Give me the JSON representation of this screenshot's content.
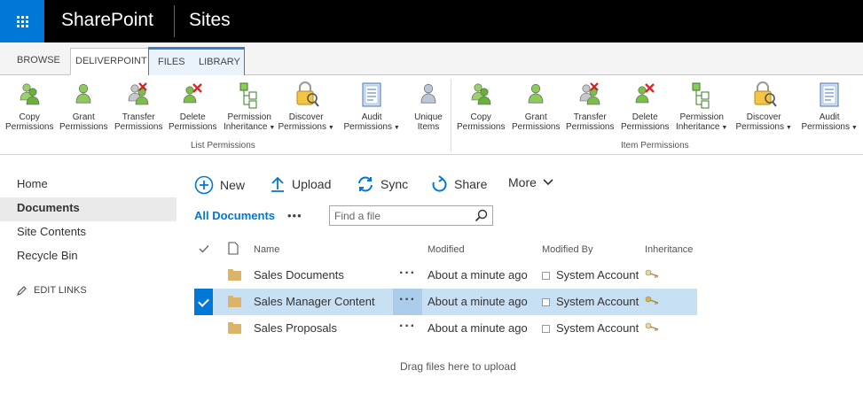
{
  "suite": {
    "app_name": "SharePoint",
    "site_name": "Sites"
  },
  "ribbon": {
    "tabs": [
      "BROWSE",
      "DELIVERPOINT",
      "FILES",
      "LIBRARY"
    ],
    "list_group": {
      "label": "List Permissions",
      "buttons": [
        {
          "l1": "Copy",
          "l2": "Permissions",
          "icon": "copy-permissions-icon"
        },
        {
          "l1": "Grant",
          "l2": "Permissions",
          "icon": "grant-permissions-icon"
        },
        {
          "l1": "Transfer",
          "l2": "Permissions",
          "icon": "transfer-permissions-icon"
        },
        {
          "l1": "Delete",
          "l2": "Permissions",
          "icon": "delete-permissions-icon"
        },
        {
          "l1": "Permission",
          "l2": "Inheritance",
          "icon": "permission-inheritance-icon"
        },
        {
          "l1": "Discover",
          "l2": "Permissions",
          "icon": "discover-permissions-icon"
        },
        {
          "l1": "Audit",
          "l2": "Permissions",
          "icon": "audit-permissions-icon"
        },
        {
          "l1": "Unique",
          "l2": "Items",
          "icon": "unique-items-icon"
        }
      ]
    },
    "item_group": {
      "label": "Item Permissions",
      "buttons": [
        {
          "l1": "Copy",
          "l2": "Permissions",
          "icon": "copy-permissions-icon"
        },
        {
          "l1": "Grant",
          "l2": "Permissions",
          "icon": "grant-permissions-icon"
        },
        {
          "l1": "Transfer",
          "l2": "Permissions",
          "icon": "transfer-permissions-icon"
        },
        {
          "l1": "Delete",
          "l2": "Permissions",
          "icon": "delete-permissions-icon"
        },
        {
          "l1": "Permission",
          "l2": "Inheritance",
          "icon": "permission-inheritance-icon"
        },
        {
          "l1": "Discover",
          "l2": "Permissions",
          "icon": "discover-permissions-icon"
        },
        {
          "l1": "Audit",
          "l2": "Permissions",
          "icon": "audit-permissions-icon"
        }
      ]
    }
  },
  "leftnav": {
    "items": [
      "Home",
      "Documents",
      "Site Contents",
      "Recycle Bin"
    ],
    "active": "Documents",
    "edit_links": "EDIT LINKS"
  },
  "commands": {
    "new": "New",
    "upload": "Upload",
    "sync": "Sync",
    "share": "Share",
    "more": "More"
  },
  "view": {
    "name": "All Documents",
    "search_placeholder": "Find a file"
  },
  "list": {
    "columns": {
      "name": "Name",
      "modified": "Modified",
      "modified_by": "Modified By",
      "inheritance": "Inheritance"
    },
    "rows": [
      {
        "name": "Sales Documents",
        "modified": "About a minute ago",
        "modified_by": "System Account",
        "selected": false
      },
      {
        "name": "Sales Manager Content",
        "modified": "About a minute ago",
        "modified_by": "System Account",
        "selected": true
      },
      {
        "name": "Sales Proposals",
        "modified": "About a minute ago",
        "modified_by": "System Account",
        "selected": false
      }
    ]
  },
  "dropzone": "Drag files here to upload",
  "colors": {
    "accent": "#0078d7",
    "selected_row": "#c7e0f4",
    "suitebar": "#000000"
  }
}
